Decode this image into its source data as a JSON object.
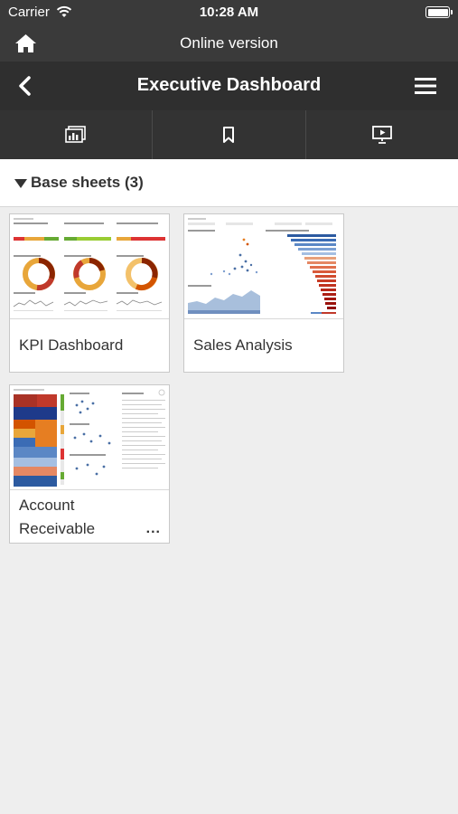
{
  "status": {
    "carrier": "Carrier",
    "time": "10:28 AM"
  },
  "online": {
    "title": "Online version"
  },
  "nav": {
    "title": "Executive Dashboard"
  },
  "tabs": [
    {
      "icon": "sheets-icon"
    },
    {
      "icon": "bookmark-icon"
    },
    {
      "icon": "present-icon"
    }
  ],
  "section": {
    "label": "Base sheets (3)"
  },
  "sheets": [
    {
      "name": "KPI Dashboard"
    },
    {
      "name": "Sales Analysis"
    },
    {
      "name_line1": "Account",
      "name_line2": "Receivable",
      "more": "..."
    }
  ],
  "colors": {
    "bar_dark": "#3a3a3a",
    "nav_dark": "#2f2f2f",
    "background": "#eeeeee"
  }
}
